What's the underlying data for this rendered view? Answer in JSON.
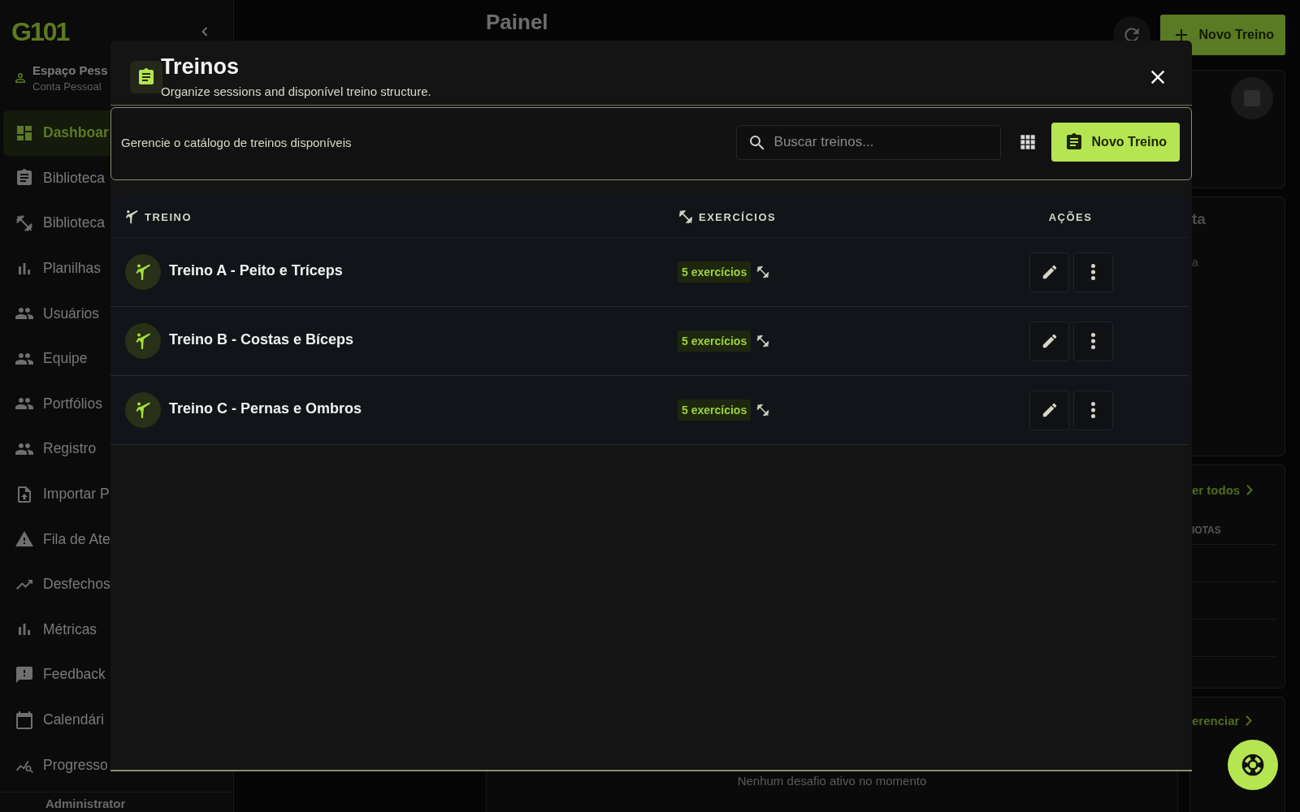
{
  "sidebar": {
    "logo": "G101",
    "workspace": {
      "name": "Espaço Pess",
      "type": "Conta Pessoal"
    },
    "items": [
      {
        "label": "Dashboar",
        "kind": "dashboard",
        "selected": true
      },
      {
        "label": "Biblioteca",
        "kind": "library",
        "selected": false
      },
      {
        "label": "Biblioteca",
        "kind": "exercises",
        "selected": false
      },
      {
        "label": "Planilhas",
        "kind": "sheets",
        "selected": false
      },
      {
        "label": "Usuários",
        "kind": "users",
        "selected": false
      },
      {
        "label": "Equipe",
        "kind": "users",
        "selected": false
      },
      {
        "label": "Portfólios",
        "kind": "users",
        "selected": false
      },
      {
        "label": "Registro",
        "kind": "users",
        "selected": false
      },
      {
        "label": "Importar P",
        "kind": "import",
        "selected": false
      },
      {
        "label": "Fila de Ate",
        "kind": "queue",
        "selected": false
      },
      {
        "label": "Desfechos",
        "kind": "outcomes",
        "selected": false
      },
      {
        "label": "Métricas",
        "kind": "metrics",
        "selected": false
      },
      {
        "label": "Feedback",
        "kind": "feedback",
        "selected": false
      },
      {
        "label": "Calendári",
        "kind": "calendar",
        "selected": false
      },
      {
        "label": "Progresso",
        "kind": "progress",
        "selected": false
      }
    ],
    "user": "Administrator"
  },
  "header": {
    "title": "Painel",
    "new_button": "Novo Treino"
  },
  "dashboard": {
    "card_title": "ta",
    "card_text": "a",
    "link_1": "er todos",
    "column_heading": "IOTAS",
    "link_2": "erenciar",
    "empty_message": "Nenhum desafio ativo no momento"
  },
  "modal": {
    "title": "Treinos",
    "subtitle": "Organize sessions and disponível treino structure.",
    "description": "Gerencie o catálogo de treinos disponíveis",
    "search": {
      "placeholder": "Buscar treinos..."
    },
    "new_button": "Novo Treino",
    "table": {
      "columns": [
        "TREINO",
        "EXERCÍCIOS",
        "AÇÕES"
      ],
      "rows": [
        {
          "name": "Treino A - Peito e Tríceps",
          "exercises": "5 exercícios"
        },
        {
          "name": "Treino B - Costas e Bíceps",
          "exercises": "5 exercícios"
        },
        {
          "name": "Treino C - Pernas e Ombros",
          "exercises": "5 exercícios"
        }
      ]
    }
  }
}
